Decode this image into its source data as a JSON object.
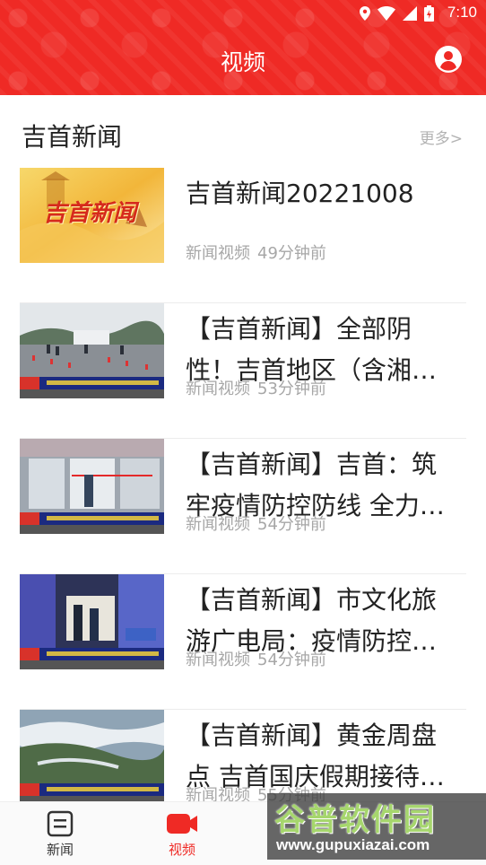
{
  "status_bar": {
    "time": "7:10"
  },
  "header": {
    "title": "视频"
  },
  "section": {
    "title": "吉首新闻",
    "more": "更多>"
  },
  "news": [
    {
      "title": "吉首新闻20221008",
      "source": "新闻视频",
      "time": "49分钟前",
      "thumb_logo": "吉首新闻"
    },
    {
      "title": "【吉首新闻】全部阴性！吉首地区（含湘西州本级）核酸检测结果",
      "source": "新闻视频",
      "time": "53分钟前",
      "thumb_logo": "吉首新闻"
    },
    {
      "title": "【吉首新闻】吉首：筑牢疫情防控防线 全力保障群众出行安全",
      "source": "新闻视频",
      "time": "54分钟前",
      "thumb_logo": "吉首新闻"
    },
    {
      "title": "【吉首新闻】市文化旅游广电局：疫情防控不放松 安全生产不松懈",
      "source": "新闻视频",
      "time": "54分钟前",
      "thumb_logo": "吉首新闻"
    },
    {
      "title": "【吉首新闻】黄金周盘点 吉首国庆假期接待游客",
      "source": "新闻视频",
      "time": "55分钟前",
      "thumb_logo": "吉首新闻"
    }
  ],
  "bottom_nav": [
    {
      "label": "新闻",
      "icon": "news-icon",
      "active": false
    },
    {
      "label": "视频",
      "icon": "video-icon",
      "active": true
    }
  ],
  "watermark": {
    "brand": "谷普软件园",
    "url": "www.gupuxiazai.com"
  },
  "colors": {
    "primary": "#ef2a25",
    "text": "#222222",
    "meta": "#a7a7a7"
  }
}
